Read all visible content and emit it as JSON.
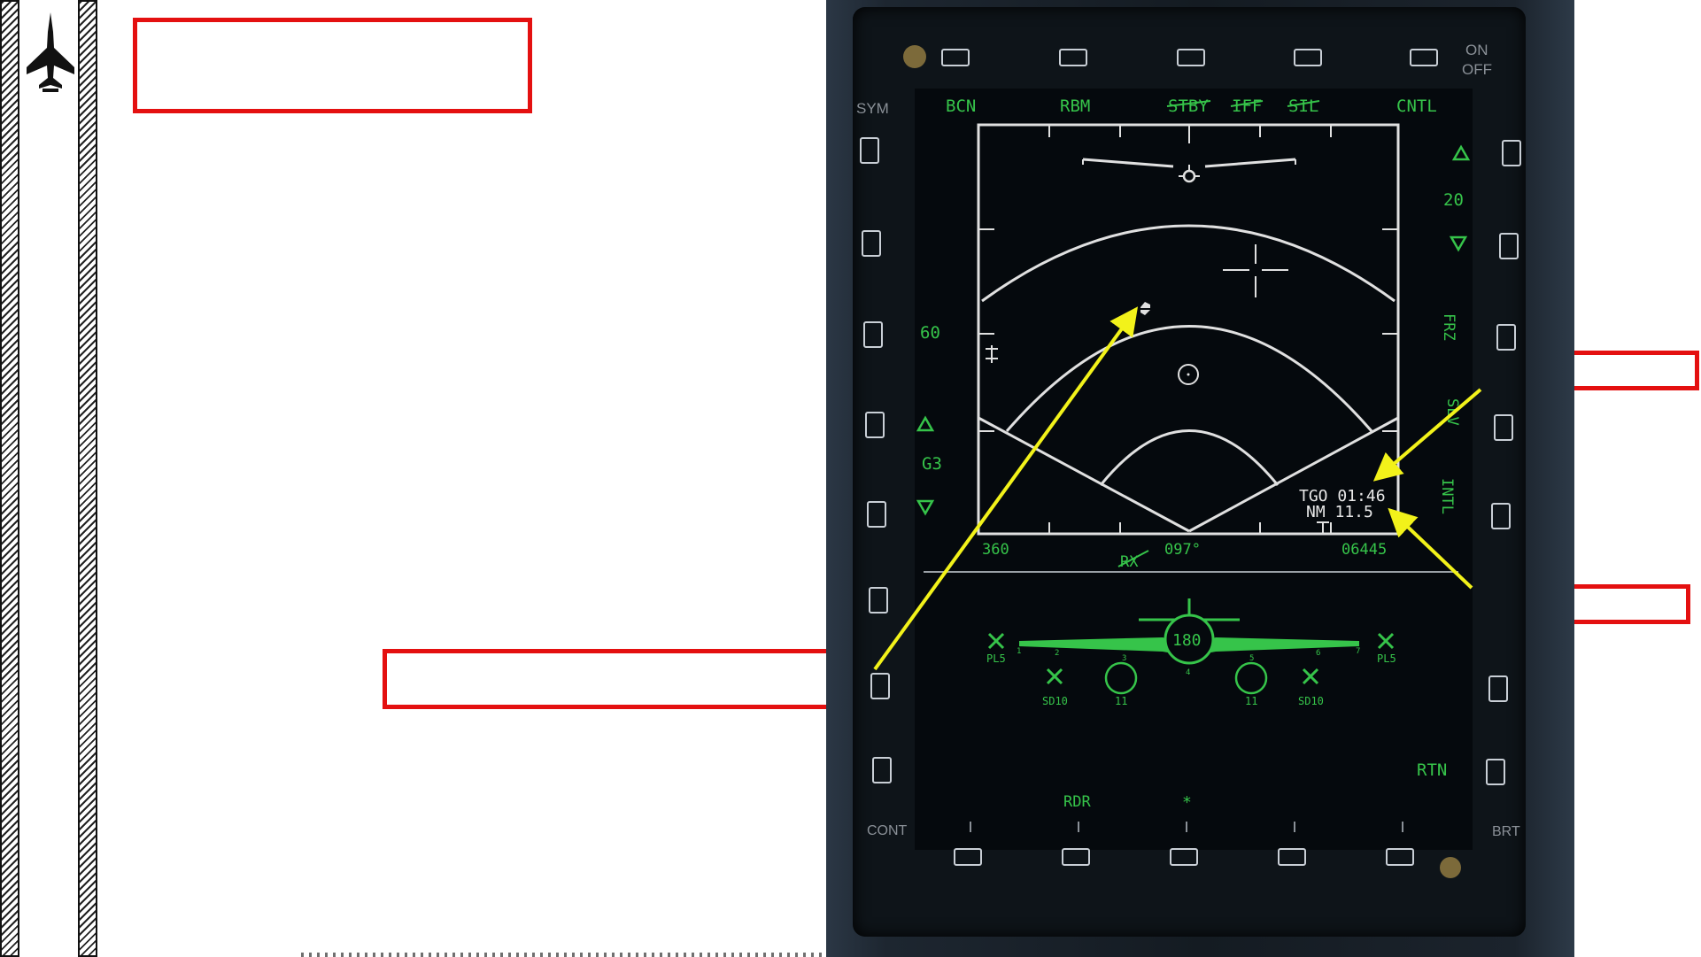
{
  "mfd": {
    "top_row": [
      "BCN",
      "RBM",
      "STBY",
      "IFF",
      "SIL",
      "CNTL"
    ],
    "sym": "SYM",
    "on_off": [
      "ON",
      "OFF"
    ],
    "right_side": {
      "range": "20",
      "frz": "FRZ",
      "slv": "SLV",
      "intl": "INTL",
      "rtn": "RTN"
    },
    "left_side": {
      "elev": "60",
      "gain": "G3"
    },
    "radar_bottom": {
      "left": "360",
      "heading": "097°",
      "right": "06445",
      "rx": "RX"
    },
    "nav_box": {
      "tgo": "TGO 01:46",
      "nm": "NM  11.5"
    },
    "stores": {
      "center": "180",
      "stations": [
        "1",
        "2",
        "3",
        "4",
        "5",
        "6",
        "7"
      ],
      "labels": [
        "PL5",
        "SD10",
        "11",
        "11",
        "SD10",
        "PL5"
      ]
    },
    "bottom_row": {
      "rdr": "RDR",
      "cont": "CONT",
      "brt": "BRT"
    }
  },
  "colors": {
    "mfd_green": "#36c44a",
    "callout_red": "#e41010",
    "arrow_yellow": "#f2f21a"
  }
}
